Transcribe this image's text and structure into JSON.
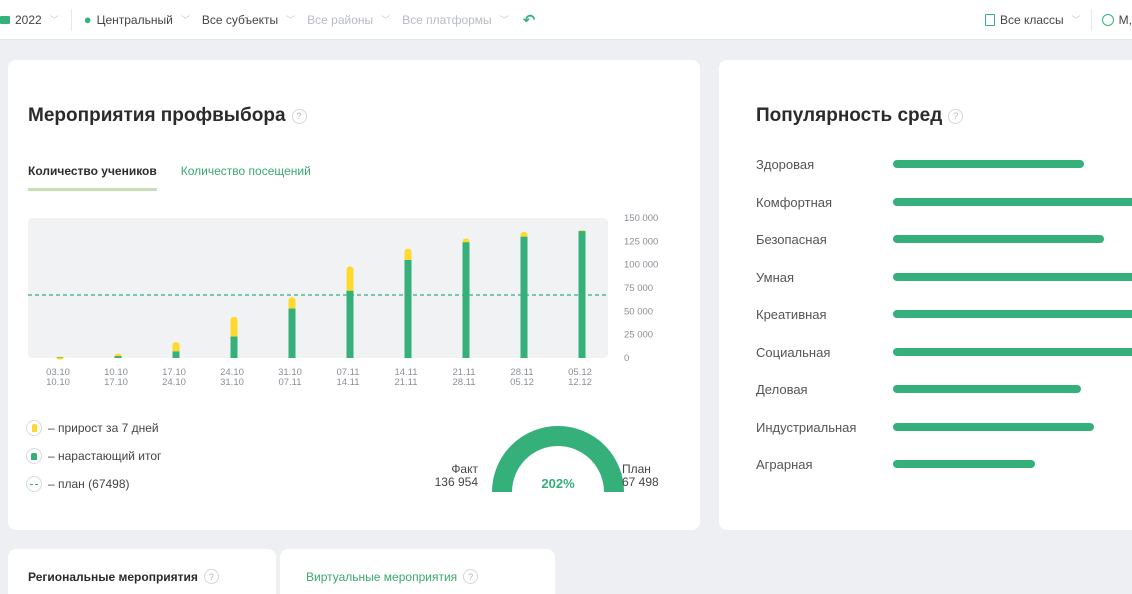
{
  "filters": {
    "year": "2022",
    "district": "Центральный",
    "subjects": "Все субъекты",
    "regions": "Все районы",
    "platforms": "Все платформы",
    "classes": "Все классы",
    "user": "М,"
  },
  "events_card": {
    "title": "Мероприятия профвыбора",
    "help": "?",
    "tabs": [
      {
        "label": "Количество учеников",
        "active": true
      },
      {
        "label": "Количество посещений",
        "active": false
      }
    ]
  },
  "chart_data": {
    "type": "bar",
    "categories": [
      "03.10\n10.10",
      "10.10\n17.10",
      "17.10\n24.10",
      "24.10\n31.10",
      "31.10\n07.11",
      "07.11\n14.11",
      "14.11\n21.11",
      "21.11\n28.11",
      "28.11\n05.12",
      "05.12\n12.12"
    ],
    "category_lines": [
      [
        "03.10",
        "10.10"
      ],
      [
        "10.10",
        "17.10"
      ],
      [
        "17.10",
        "24.10"
      ],
      [
        "24.10",
        "31.10"
      ],
      [
        "31.10",
        "07.11"
      ],
      [
        "07.11",
        "14.11"
      ],
      [
        "14.11",
        "21.11"
      ],
      [
        "21.11",
        "28.11"
      ],
      [
        "28.11",
        "05.12"
      ],
      [
        "05.12",
        "12.12"
      ]
    ],
    "series": [
      {
        "name": "нарастающий итог",
        "values": [
          500,
          2000,
          7000,
          23000,
          53000,
          72000,
          105000,
          124000,
          130000,
          136000
        ]
      },
      {
        "name": "прирост за 7 дней",
        "values": [
          1000,
          2500,
          10000,
          21000,
          12000,
          26000,
          12000,
          4000,
          5000,
          954
        ]
      }
    ],
    "plan": 67498,
    "ylim": [
      0,
      150000
    ],
    "yticks": [
      "0",
      "25 000",
      "50 000",
      "75 000",
      "100 000",
      "125 000",
      "150 000"
    ],
    "colors": {
      "total": "#35b07a",
      "growth": "#ffd92e",
      "plan": "#35b07a",
      "bg": "#f1f2f4"
    }
  },
  "legend": [
    {
      "label": "– прирост за 7 дней"
    },
    {
      "label": "– нарастающий итог"
    },
    {
      "label": "– план (67498)"
    }
  ],
  "gauge": {
    "fact_label": "Факт",
    "fact_value": "136 954",
    "plan_label": "План",
    "plan_value": "67 498",
    "percent": "202%",
    "fill_fraction": 1.0
  },
  "popularity": {
    "title": "Популярность сред",
    "help": "?",
    "items": [
      {
        "label": "Здоровая",
        "value": 0.58
      },
      {
        "label": "Комфортная",
        "value": 0.75
      },
      {
        "label": "Безопасная",
        "value": 0.64
      },
      {
        "label": "Умная",
        "value": 0.75
      },
      {
        "label": "Креативная",
        "value": 0.75
      },
      {
        "label": "Социальная",
        "value": 0.75
      },
      {
        "label": "Деловая",
        "value": 0.57
      },
      {
        "label": "Индустриальная",
        "value": 0.61
      },
      {
        "label": "Аграрная",
        "value": 0.43
      }
    ]
  },
  "bottom_tabs": {
    "regional": "Региональные мероприятия",
    "virtual": "Виртуальные мероприятия",
    "help": "?"
  }
}
